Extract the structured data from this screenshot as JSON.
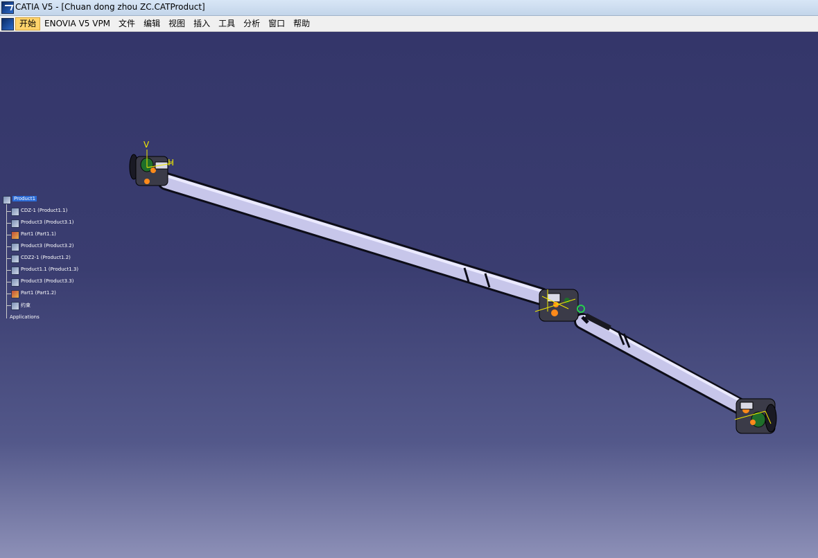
{
  "titlebar": {
    "title": "CATIA V5 - [Chuan dong zhou ZC.CATProduct]"
  },
  "menubar": {
    "items": [
      "开始",
      "ENOVIA V5 VPM",
      "文件",
      "编辑",
      "视图",
      "插入",
      "工具",
      "分析",
      "窗口",
      "帮助"
    ]
  },
  "tree": {
    "root": "Product1",
    "children": [
      "CDZ-1 (Product1.1)",
      "Product3 (Product3.1)",
      "Part1 (Part1.1)",
      "Product3 (Product3.2)",
      "CDZ2-1 (Product1.2)",
      "Product1.1 (Product1.3)",
      "Product3 (Product3.3)",
      "Part1 (Part1.2)",
      "约束"
    ],
    "applications": "Applications"
  },
  "axis_labels": {
    "v": "V",
    "h": "H"
  },
  "colors": {
    "background": "#3a3c6c",
    "shaft": "#c7c6ea",
    "joint_green": "#1f6f2a",
    "accent_orange": "#ff8a1a"
  }
}
